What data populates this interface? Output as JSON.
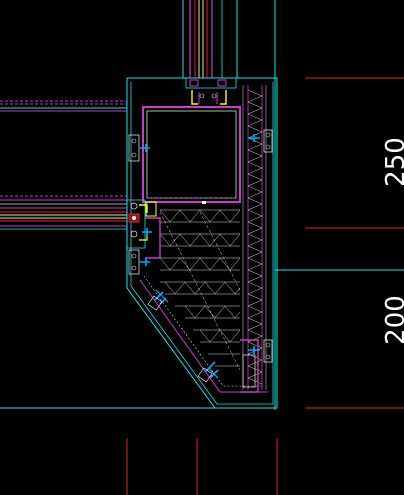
{
  "drawing": {
    "background": "#000000",
    "colors": {
      "outline": "#19e6e6",
      "steel": "#c83cc8",
      "dimension": "#e61e1e",
      "glass": "#f0e68c",
      "text": "#ffffff",
      "cut_line": "#dcdcdc",
      "bolt": "#00aaff",
      "accent": "#ffff00"
    },
    "dimension_texts": [
      "250",
      "200"
    ]
  }
}
